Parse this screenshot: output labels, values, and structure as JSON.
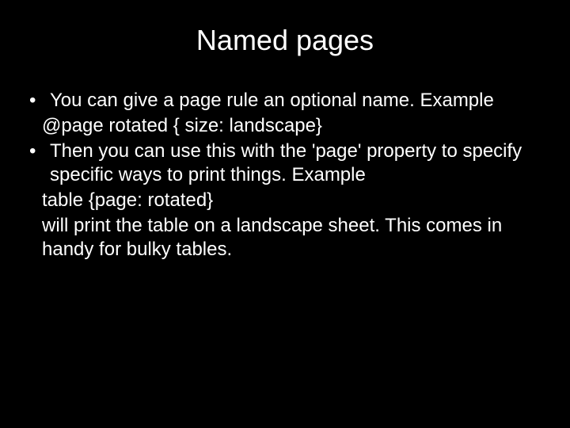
{
  "slide": {
    "title": "Named pages",
    "bullets": [
      {
        "marker": "•",
        "text": "You can give a page rule an optional name. Example"
      },
      {
        "marker": "•",
        "text": "Then you can use this with the 'page' property to specify specific  ways to print things. Example"
      }
    ],
    "lines": {
      "code1": "@page rotated { size: landscape}",
      "code2": "table {page: rotated}",
      "closing": "will print the table on a landscape sheet. This comes in handy for bulky tables."
    }
  }
}
